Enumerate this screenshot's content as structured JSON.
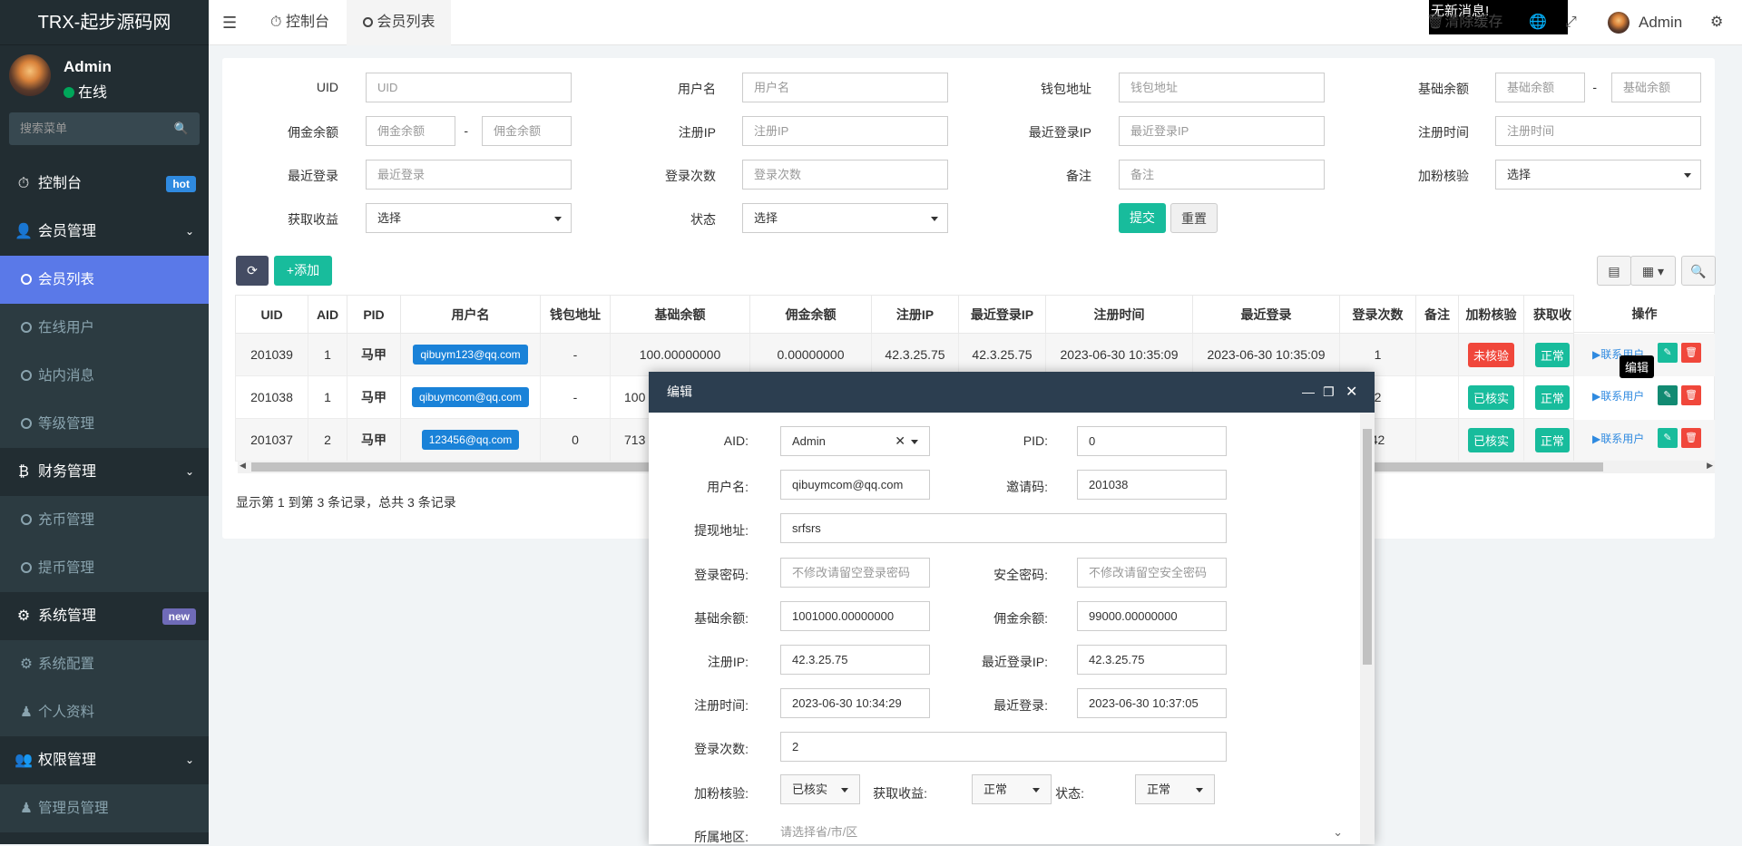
{
  "app": {
    "logo": "TRX-起步源码网",
    "user": "Admin",
    "status": "在线",
    "search_placeholder": "搜索菜单"
  },
  "menu": [
    {
      "label": "控制台",
      "icon": "dashboard-icon",
      "badge": "hot"
    },
    {
      "label": "会员管理",
      "icon": "user-icon"
    },
    {
      "label": "会员列表",
      "sub": true,
      "active": true
    },
    {
      "label": "在线用户",
      "sub": true
    },
    {
      "label": "站内消息",
      "sub": true
    },
    {
      "label": "等级管理",
      "sub": true
    },
    {
      "label": "财务管理",
      "icon": "bitcoin-icon"
    },
    {
      "label": "充币管理",
      "sub": true
    },
    {
      "label": "提币管理",
      "sub": true
    },
    {
      "label": "系统管理",
      "icon": "cogs-icon",
      "badge": "new"
    },
    {
      "label": "系统配置",
      "sub": true
    },
    {
      "label": "个人资料",
      "sub": true
    },
    {
      "label": "权限管理",
      "icon": "users-icon"
    },
    {
      "label": "管理员管理",
      "sub": true
    }
  ],
  "topbar": {
    "tab1": "控制台",
    "tab2": "会员列表",
    "notice": "无新消息!",
    "clear_cache": "清除缓存",
    "admin": "Admin"
  },
  "filters": {
    "uid": "UID",
    "uid_ph": "UID",
    "username": "用户名",
    "username_ph": "用户名",
    "wallet": "钱包地址",
    "wallet_ph": "钱包地址",
    "base_balance": "基础余额",
    "base_ph": "基础余额",
    "commission": "佣金余额",
    "commission_ph": "佣金余额",
    "reg_ip": "注册IP",
    "reg_ip_ph": "注册IP",
    "last_ip": "最近登录IP",
    "last_ip_ph": "最近登录IP",
    "reg_time": "注册时间",
    "reg_time_ph": "注册时间",
    "last_login": "最近登录",
    "last_login_ph": "最近登录",
    "login_count": "登录次数",
    "login_count_ph": "登录次数",
    "remark": "备注",
    "remark_ph": "备注",
    "fans_check": "加粉核验",
    "select": "选择",
    "get_income": "获取收益",
    "status": "状态",
    "submit": "提交",
    "reset": "重置",
    "dash": "-"
  },
  "toolbar": {
    "add": "添加"
  },
  "table": {
    "headers": [
      "UID",
      "AID",
      "PID",
      "用户名",
      "钱包地址",
      "基础余额",
      "佣金余额",
      "注册IP",
      "最近登录IP",
      "注册时间",
      "最近登录",
      "登录次数",
      "备注",
      "加粉核验",
      "获取收"
    ],
    "ops_header": "操作",
    "rows": [
      [
        "201039",
        "1",
        "马甲",
        "qibuym123@qq.com",
        "-",
        "100.00000000",
        "0.00000000",
        "42.3.25.75",
        "42.3.25.75",
        "2023-06-30 10:35:09",
        "2023-06-30 10:35:09",
        "1",
        "",
        "未核验",
        "正常"
      ],
      [
        "201038",
        "1",
        "马甲",
        "qibuymcom@qq.com",
        "-",
        "100",
        "",
        "",
        "",
        "",
        "",
        "2",
        "",
        "已核实",
        "正常"
      ],
      [
        "201037",
        "2",
        "马甲",
        "123456@qq.com",
        "0",
        "713",
        "",
        "",
        "",
        "",
        "",
        "42",
        "",
        "已核实",
        "正常"
      ]
    ],
    "contact": "联系用户",
    "footer": "显示第 1 到第 3 条记录，总共 3 条记录",
    "tooltip": "编辑"
  },
  "modal": {
    "title": "编辑",
    "aid_l": "AID:",
    "aid_v": "Admin",
    "pid_l": "PID:",
    "pid_v": "0",
    "user_l": "用户名:",
    "user_v": "qibuymcom@qq.com",
    "invite_l": "邀请码:",
    "invite_v": "201038",
    "withdraw_l": "提现地址:",
    "withdraw_v": "srfsrs",
    "pwd_l": "登录密码:",
    "pwd_ph": "不修改请留空登录密码",
    "spwd_l": "安全密码:",
    "spwd_ph": "不修改请留空安全密码",
    "base_l": "基础余额:",
    "base_v": "1001000.00000000",
    "comm_l": "佣金余额:",
    "comm_v": "99000.00000000",
    "regip_l": "注册IP:",
    "regip_v": "42.3.25.75",
    "lastip_l": "最近登录IP:",
    "lastip_v": "42.3.25.75",
    "regtime_l": "注册时间:",
    "regtime_v": "2023-06-30 10:34:29",
    "lastlogin_l": "最近登录:",
    "lastlogin_v": "2023-06-30 10:37:05",
    "count_l": "登录次数:",
    "count_v": "2",
    "fans_l": "加粉核验:",
    "fans_v": "已核实",
    "income_l": "获取收益:",
    "income_v": "正常",
    "status_l": "状态:",
    "status_v": "正常",
    "region_l": "所属地区:",
    "region_ph": "请选择省/市/区"
  }
}
